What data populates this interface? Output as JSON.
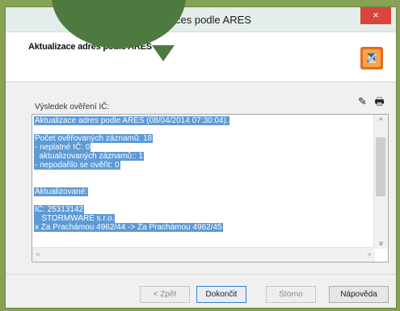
{
  "window": {
    "title": "ces podle ARES",
    "close_label": "×"
  },
  "header": {
    "title": "Aktualizace adres podle ARES"
  },
  "section": {
    "label": "Výsledek ověření IČ:"
  },
  "toolbar": {
    "edit_icon": "✎",
    "print_icon": "🖶"
  },
  "log": {
    "lines": [
      "Aktualizace adres podle ARES (08/04/2014 07:30:04).",
      "",
      "Počet ověřovaných záznamů: 18",
      "- neplatné IČ: 0",
      "  aktualizovaných záznamů:: 1",
      "- nepodařilo se ověřit: 0",
      "",
      "",
      "Aktualizované:",
      "",
      "IČ: 25313142",
      "   STORMWARE s.r.o.",
      "x Za Prachámou 4962/44 -> Za Prachámou 4962/45"
    ]
  },
  "scroll": {
    "up": "^",
    "down": "v",
    "left": "<",
    "right": ">"
  },
  "buttons": {
    "back": "< Zpět",
    "finish": "Dokončit",
    "cancel": "Storno",
    "help": "Nápověda"
  }
}
